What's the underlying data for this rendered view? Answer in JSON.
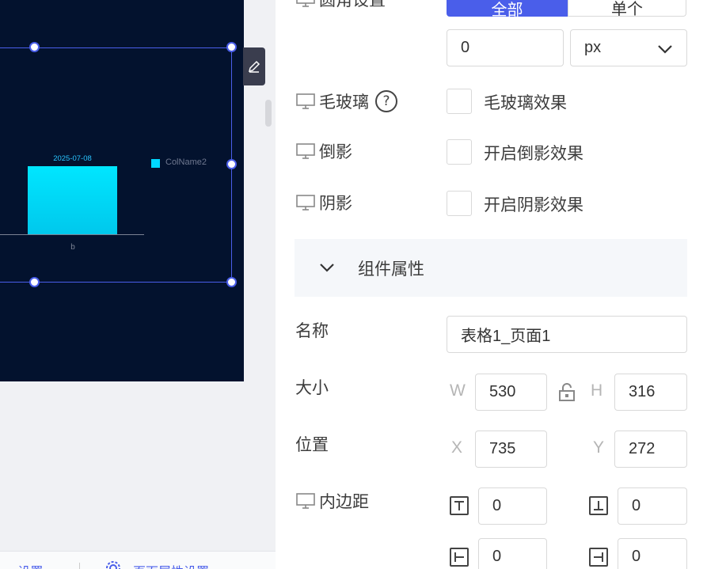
{
  "canvas": {
    "chart_data": {
      "type": "bar",
      "categories": [
        "b"
      ],
      "series": [
        {
          "name": "ColName2",
          "values": [
            1
          ]
        }
      ],
      "data_labels": [
        "2025-07-08"
      ],
      "legend_position": "right",
      "colors": {
        "bar": "#00e6ff",
        "background": "#03122e",
        "selection": "#4a5eea"
      }
    },
    "bottom_bar": {
      "left_text": "....设置",
      "right_text": "页面属性设置"
    }
  },
  "panel": {
    "radius_row": {
      "label": "圆角设置",
      "segment_all": "全部",
      "segment_single": "单个",
      "value": "0",
      "unit": "px"
    },
    "frosted": {
      "label": "毛玻璃",
      "help_icon": "question-icon",
      "checkbox_label": "毛玻璃效果",
      "checked": false
    },
    "reflection": {
      "label": "倒影",
      "checkbox_label": "开启倒影效果",
      "checked": false
    },
    "shadow": {
      "label": "阴影",
      "checkbox_label": "开启阴影效果",
      "checked": false
    },
    "section": {
      "title": "组件属性"
    },
    "name": {
      "label": "名称",
      "value": "表格1_页面1"
    },
    "size": {
      "label": "大小",
      "w_prefix": "W",
      "w": "530",
      "h_prefix": "H",
      "h": "316"
    },
    "position": {
      "label": "位置",
      "x_prefix": "X",
      "x": "735",
      "y_prefix": "Y",
      "y": "272"
    },
    "padding": {
      "label": "内边距",
      "top": "0",
      "bottom": "0",
      "left": "0",
      "right": "0"
    }
  }
}
